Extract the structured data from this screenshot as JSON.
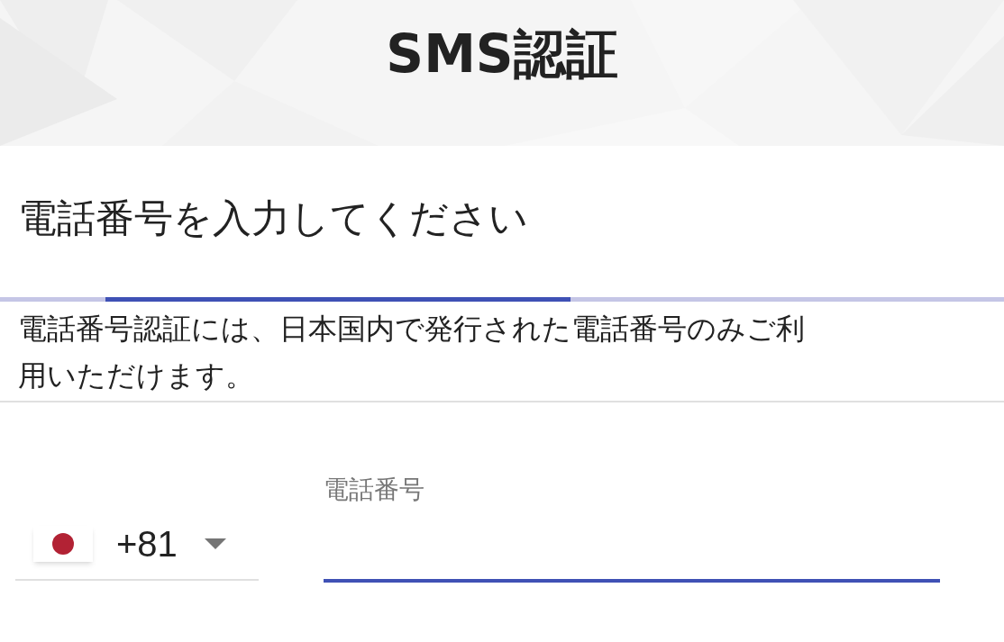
{
  "header": {
    "title": "SMS認証"
  },
  "heading": "電話番号を入力してください",
  "notice": "電話番号認証には、日本国内で発行された電話番号のみご利用いただけます。",
  "country_select": {
    "value": "+81"
  },
  "phone_field": {
    "label": "電話番号"
  }
}
